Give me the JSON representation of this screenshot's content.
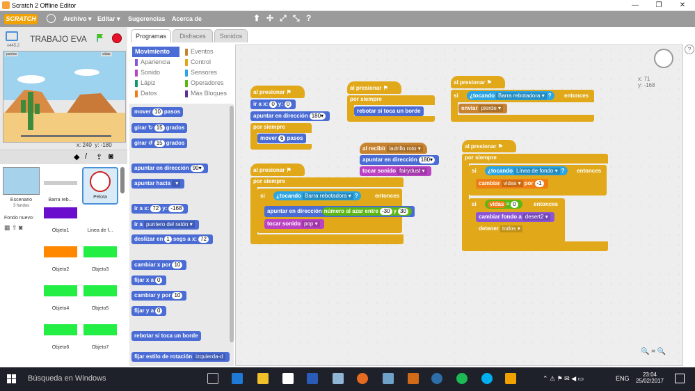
{
  "window": {
    "title": "Scratch 2 Offline Editor",
    "min": "—",
    "max": "❐",
    "close": "✕"
  },
  "menubar": {
    "logo": "SCRATCH",
    "items": [
      "Archivo ▾",
      "Editar ▾",
      "Sugerencias",
      "Acerca de"
    ],
    "tools": [
      "⬆︎",
      "✢",
      "⤢",
      "⤡",
      "?"
    ]
  },
  "stage": {
    "project_name": "TRABAJO EVA",
    "version": "v445.2",
    "coords_x": "x: 240",
    "coords_y": "y: -180",
    "var1": "puntos",
    "var2": "vidas"
  },
  "sprites": {
    "stage_label": "Escenario",
    "stage_sub": "3 fondos",
    "new_bg": "Fondo nuevo:",
    "items": [
      {
        "name": "Barra reb...",
        "color": "#cccccc"
      },
      {
        "name": "Pelota",
        "color": "#ffffff"
      },
      {
        "name": "Objeto1",
        "color": "#6a0dcc"
      },
      {
        "name": "Linea de f...",
        "color": "#ffffff"
      },
      {
        "name": "Objeto2",
        "color": "#ff8800"
      },
      {
        "name": "Objeto3",
        "color": "#22ee44"
      },
      {
        "name": "Objeto4",
        "color": "#22ee44"
      },
      {
        "name": "Objeto5",
        "color": "#22ee44"
      },
      {
        "name": "Objeto6",
        "color": "#22ee44"
      },
      {
        "name": "Objeto7",
        "color": "#22ee44"
      }
    ]
  },
  "tabs": [
    "Programas",
    "Disfraces",
    "Sonidos"
  ],
  "categories": [
    {
      "name": "Movimiento",
      "color": "#4a6cd4"
    },
    {
      "name": "Eventos",
      "color": "#c88330"
    },
    {
      "name": "Apariencia",
      "color": "#8a55d7"
    },
    {
      "name": "Control",
      "color": "#e1a91a"
    },
    {
      "name": "Sonido",
      "color": "#bb42c3"
    },
    {
      "name": "Sensores",
      "color": "#2ca5e2"
    },
    {
      "name": "Lápiz",
      "color": "#0e9a6c"
    },
    {
      "name": "Operadores",
      "color": "#5cb712"
    },
    {
      "name": "Datos",
      "color": "#ee7d16"
    },
    {
      "name": "Más Bloques",
      "color": "#632d99"
    }
  ],
  "palette": {
    "mover": "mover",
    "pasos": "pasos",
    "mover_val": "10",
    "girar": "girar",
    "grados": "grados",
    "girar_val": "15",
    "apuntar_dir": "apuntar en dirección",
    "apuntar_dir_val": "90▾",
    "apuntar_hacia": "apuntar hacia",
    "ir_a": "ir a x:",
    "ir_y": "y:",
    "ir_x_val": "72",
    "ir_y_val": "-168",
    "ir_a2": "ir a",
    "puntero": "puntero del ratón ▾",
    "deslizar": "deslizar en",
    "segs": "segs a x:",
    "deslizar_val": "1",
    "deslizar_x": "72",
    "cambiar_x": "cambiar x por",
    "cambiar_x_val": "10",
    "fijar_x": "fijar x a",
    "fijar_x_val": "0",
    "cambiar_y": "cambiar y por",
    "cambiar_y_val": "10",
    "fijar_y": "fijar y a",
    "fijar_y_val": "0",
    "rebotar": "rebotar si toca un borde",
    "estilo": "fijar estilo de rotación",
    "estilo_val": "izquierda-d"
  },
  "scripts": {
    "al_presionar": "al presionar",
    "s1_ir": "ir a x:",
    "s1_x": "0",
    "s1_y": "0",
    "y_lbl": "y:",
    "s1_apuntar": "apuntar en dirección",
    "s1_dir": "180▾",
    "por_siempre": "por siempre",
    "s1_mover": "mover",
    "s1_pasos": "pasos",
    "s1_mover_val": "6",
    "s2_rebotar": "rebotar si toca un borde",
    "si": "si",
    "entonces": "entonces",
    "tocando": "¿tocando",
    "tocando_q": "?",
    "barra": "Barra rebotadora ▾",
    "linea": "Línea de fondo ▾",
    "enviar": "enviar",
    "pierde": "pierde ▾",
    "al_recibir": "al recibir",
    "ladrillo": "ladrillo roto ▾",
    "apuntar_dir": "apuntar en dirección",
    "dir180": "180▾",
    "tocar_sonido": "tocar sonido",
    "fairydust": "fairydust ▾",
    "pop": "pop ▾",
    "azar": "número al azar entre",
    "azar_a": "-30",
    "azar_y": "y",
    "azar_b": "30",
    "cambiar": "cambiar",
    "vidas_drop": "vidas ▾",
    "por": "por",
    "menos1": "-1",
    "vidas": "vidas",
    "eq": "=",
    "cero": "0",
    "cambiar_fondo": "cambiar fondo a",
    "desert2": "desert2 ▾",
    "detener": "detener",
    "todos": "todos ▾",
    "sprite_x": "x: 71",
    "sprite_y": "y: -168",
    "zoom": "🔍  =  🔍"
  },
  "taskbar": {
    "search": "Búsqueda en Windows",
    "time": "23:04",
    "date": "25/02/2017",
    "lang": "ENG"
  }
}
